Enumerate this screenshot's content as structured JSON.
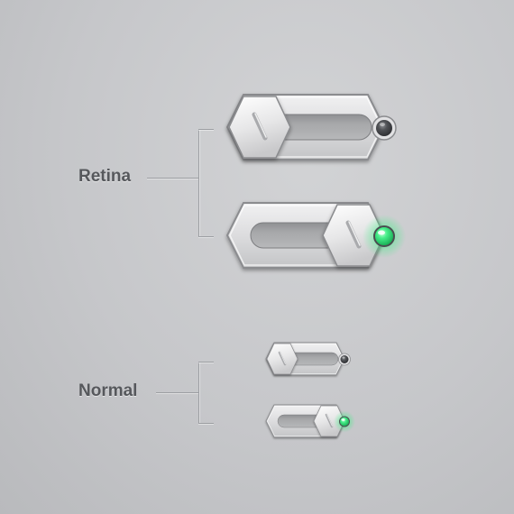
{
  "groups": {
    "retina": {
      "label": "Retina"
    },
    "normal": {
      "label": "Normal"
    }
  },
  "toggles": [
    {
      "id": "retina-off",
      "state": "off"
    },
    {
      "id": "retina-on",
      "state": "on"
    },
    {
      "id": "normal-off",
      "state": "off"
    },
    {
      "id": "normal-on",
      "state": "on"
    }
  ],
  "colors": {
    "led_on": "#33e07a",
    "led_off": "#4a4c50",
    "background": "#c6c7ca"
  }
}
